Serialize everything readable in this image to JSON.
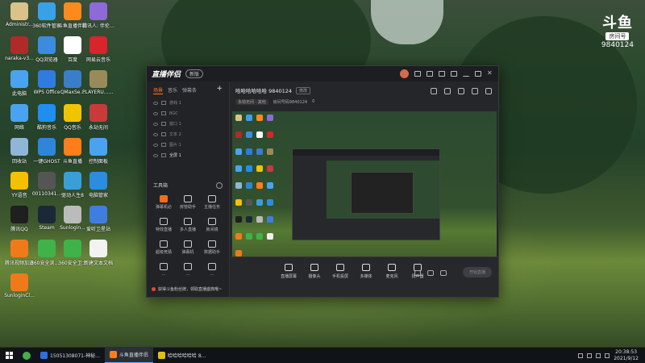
{
  "desktop": {
    "icons": [
      {
        "label": "Administr...",
        "color": "#d9c38a"
      },
      {
        "label": "360软件管家",
        "color": "#3aa0e8"
      },
      {
        "label": "斗鱼直播伴侣",
        "color": "#ff8a1c"
      },
      {
        "label": "腾讯人: 伴伦视频",
        "color": "#8e6ad8"
      },
      {
        "label": "naraka-v3...",
        "color": "#b02a2a"
      },
      {
        "label": "QQ浏览器",
        "color": "#3d8be0"
      },
      {
        "label": "百度",
        "color": "#ffffff"
      },
      {
        "label": "网易云音乐",
        "color": "#d8242b"
      },
      {
        "label": "此电脑",
        "color": "#4aa3f0"
      },
      {
        "label": "WPS Office",
        "color": "#2f7be0"
      },
      {
        "label": "QMaxSe...",
        "color": "#3a7dc9"
      },
      {
        "label": "PLAYERU... BATTLEGR...",
        "color": "#9a8a5a"
      },
      {
        "label": "网络",
        "color": "#4aa3f0"
      },
      {
        "label": "酷狗音乐",
        "color": "#1f8ef0"
      },
      {
        "label": "QQ音乐",
        "color": "#f0c400"
      },
      {
        "label": "永劫无间",
        "color": "#c93a3a"
      },
      {
        "label": "回收站",
        "color": "#8fb6d8"
      },
      {
        "label": "一键GHOST",
        "color": "#2d86d9"
      },
      {
        "label": "斗鱼直播",
        "color": "#ff7e1a"
      },
      {
        "label": "控制面板",
        "color": "#4aa3f0"
      },
      {
        "label": "YY语音",
        "color": "#f5c000"
      },
      {
        "label": "00110341...",
        "color": "#555555"
      },
      {
        "label": "驱动人生8",
        "color": "#3a9fd8"
      },
      {
        "label": "电脑管家",
        "color": "#2b8de0"
      },
      {
        "label": "腾讯QQ",
        "color": "#1f1f1f"
      },
      {
        "label": "Steam",
        "color": "#1b2838"
      },
      {
        "label": "Sunlogin...",
        "color": "#bbbbbb"
      },
      {
        "label": "爱听卫星站",
        "color": "#3f7ee0"
      },
      {
        "label": "腾讯视频加速",
        "color": "#f07a1a"
      },
      {
        "label": "360安全浏览器",
        "color": "#41b14a"
      },
      {
        "label": "360安全卫士",
        "color": "#3fb24a"
      },
      {
        "label": "新建文本文档",
        "color": "#f2f2f2"
      },
      {
        "label": "SunloginCl...",
        "color": "#f07a1a"
      }
    ]
  },
  "watermark": {
    "logo": "斗鱼",
    "room_label": "房间号",
    "room_number": "9840124"
  },
  "window": {
    "brand": "直播伴侣",
    "badge": "新版",
    "tabs": [
      {
        "label": "场景",
        "active": true
      },
      {
        "label": "音乐",
        "active": false
      },
      {
        "label": "弹幕条",
        "active": false
      }
    ],
    "sources": [
      {
        "label": "游戏 1",
        "on": false
      },
      {
        "label": "BGC",
        "on": false
      },
      {
        "label": "窗口 1",
        "on": false
      },
      {
        "label": "文本 2",
        "on": false
      },
      {
        "label": "图片 1",
        "on": false
      },
      {
        "label": "全屏 1",
        "on": true
      }
    ],
    "tools_title": "工具箱",
    "tools": [
      {
        "label": "弹幕机必",
        "hot": true
      },
      {
        "label": "房管助手",
        "hot": false
      },
      {
        "label": "主播任务",
        "hot": false
      },
      {
        "label": "特效直播",
        "hot": false
      },
      {
        "label": "多人直播",
        "hot": false
      },
      {
        "label": "房间镜",
        "hot": false
      },
      {
        "label": "超级竞猜",
        "hot": false
      },
      {
        "label": "弹幕机",
        "hot": false
      },
      {
        "label": "数据助手",
        "hot": false
      },
      {
        "label": "...",
        "hot": false
      },
      {
        "label": "...",
        "hot": false
      },
      {
        "label": "...",
        "hot": false
      }
    ],
    "banner": "获得斗鱼粉丝牌，领取直播盛典哦~",
    "stream_title": "哈哈哈哈哈哈 9840124",
    "edit_chip": "修改",
    "category": "永劫无间 · 其他",
    "room_info": "房间号码9840124",
    "fans": "0",
    "controls": [
      {
        "label": "直播屏幕"
      },
      {
        "label": "摄像头"
      },
      {
        "label": "手机投屏"
      },
      {
        "label": "多媒体"
      },
      {
        "label": "麦克风"
      },
      {
        "label": "扬声器"
      }
    ],
    "go_live": "开始直播"
  },
  "taskbar": {
    "apps": [
      {
        "label": "15051308071-神秘...",
        "color": "#2f6fe0",
        "selected": false
      },
      {
        "label": "斗鱼直播伴侣",
        "color": "#ff7e1a",
        "selected": true
      },
      {
        "label": "哈哈哈哈哈哈 8...",
        "color": "#e0c010",
        "selected": false
      }
    ],
    "time": "20:38:53",
    "date": "2021/9/12"
  }
}
